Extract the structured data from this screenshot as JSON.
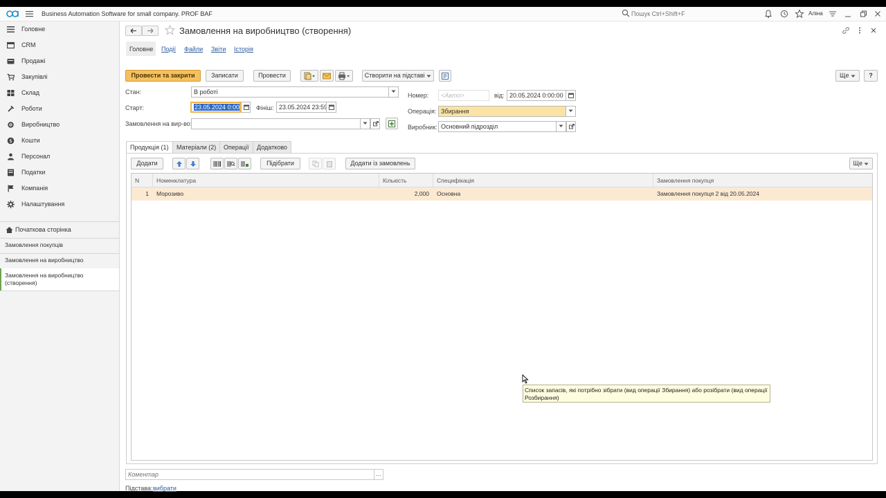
{
  "titlebar": {
    "app_title": "Business Automation Software for small company. PROF BAF",
    "search_placeholder": "Пошук Ctrl+Shift+F",
    "username": "Аліна"
  },
  "sidebar": {
    "sections": [
      {
        "label": "Головне",
        "icon": "menu-icon"
      },
      {
        "label": "CRM",
        "icon": "crm-icon"
      },
      {
        "label": "Продажі",
        "icon": "sales-icon"
      },
      {
        "label": "Закупівлі",
        "icon": "purchases-icon"
      },
      {
        "label": "Склад",
        "icon": "warehouse-icon"
      },
      {
        "label": "Роботи",
        "icon": "works-icon"
      },
      {
        "label": "Виробництво",
        "icon": "production-icon"
      },
      {
        "label": "Кошти",
        "icon": "money-icon"
      },
      {
        "label": "Персонал",
        "icon": "personnel-icon"
      },
      {
        "label": "Податки",
        "icon": "taxes-icon"
      },
      {
        "label": "Компанія",
        "icon": "company-icon"
      },
      {
        "label": "Налаштування",
        "icon": "settings-icon"
      }
    ],
    "home_label": "Початкова сторінка",
    "open_windows": [
      "Замовлення покупців",
      "Замовлення на виробництво",
      "Замовлення на виробництво (створення)"
    ]
  },
  "document": {
    "title": "Замовлення на виробництво (створення)",
    "tabs": [
      "Головне",
      "Події",
      "Файли",
      "Звіти",
      "Історія"
    ]
  },
  "toolbar": {
    "post_close": "Провести та закрити",
    "save": "Записати",
    "post": "Провести",
    "create_based": "Створити на підставі",
    "more": "Ще",
    "help": "?"
  },
  "form": {
    "state_label": "Стан:",
    "state_value": "В роботі",
    "start_label": "Старт:",
    "start_value": "23.05.2024  0:00",
    "finish_label": "Фініш:",
    "finish_value": "23.05.2024 23:59",
    "order_label": "Замовлення на вир-во:",
    "order_value": "",
    "number_label": "Номер:",
    "number_placeholder": "<Авто>",
    "date_label": "від:",
    "date_value": "20.05.2024  0:00:00",
    "operation_label": "Операція:",
    "operation_value": "Збирання",
    "producer_label": "Виробник:",
    "producer_value": "Основний підрозділ"
  },
  "inner_tabs": [
    "Продукція (1)",
    "Матеріали (2)",
    "Операції",
    "Додатково"
  ],
  "grid_toolbar": {
    "add": "Додати",
    "pick": "Підібрати",
    "add_from_orders": "Додати із замовлень",
    "more": "Ще"
  },
  "table": {
    "columns": [
      "N",
      "Номенклатура",
      "Кількість",
      "Специфікація",
      "Замовлення покупця"
    ],
    "rows": [
      [
        "1",
        "Морозиво",
        "2,000",
        "Основна",
        "Замовлення покупця 2 від 20.05.2024"
      ]
    ]
  },
  "tooltip": "Список запасів, які потрібно зібрати (вид операції Збирання) або розібрати (вид операції Розбирання)",
  "footer": {
    "comment_placeholder": "Коментар",
    "comment_btn": "...",
    "basis_label": "Підстава:",
    "basis_link": "вибрати"
  },
  "colors": {
    "accent_orange": "#f5c060",
    "link_blue": "#2e5c9e",
    "row_highlight": "#fbe9d2",
    "sidebar_active": "#6fa34d"
  }
}
